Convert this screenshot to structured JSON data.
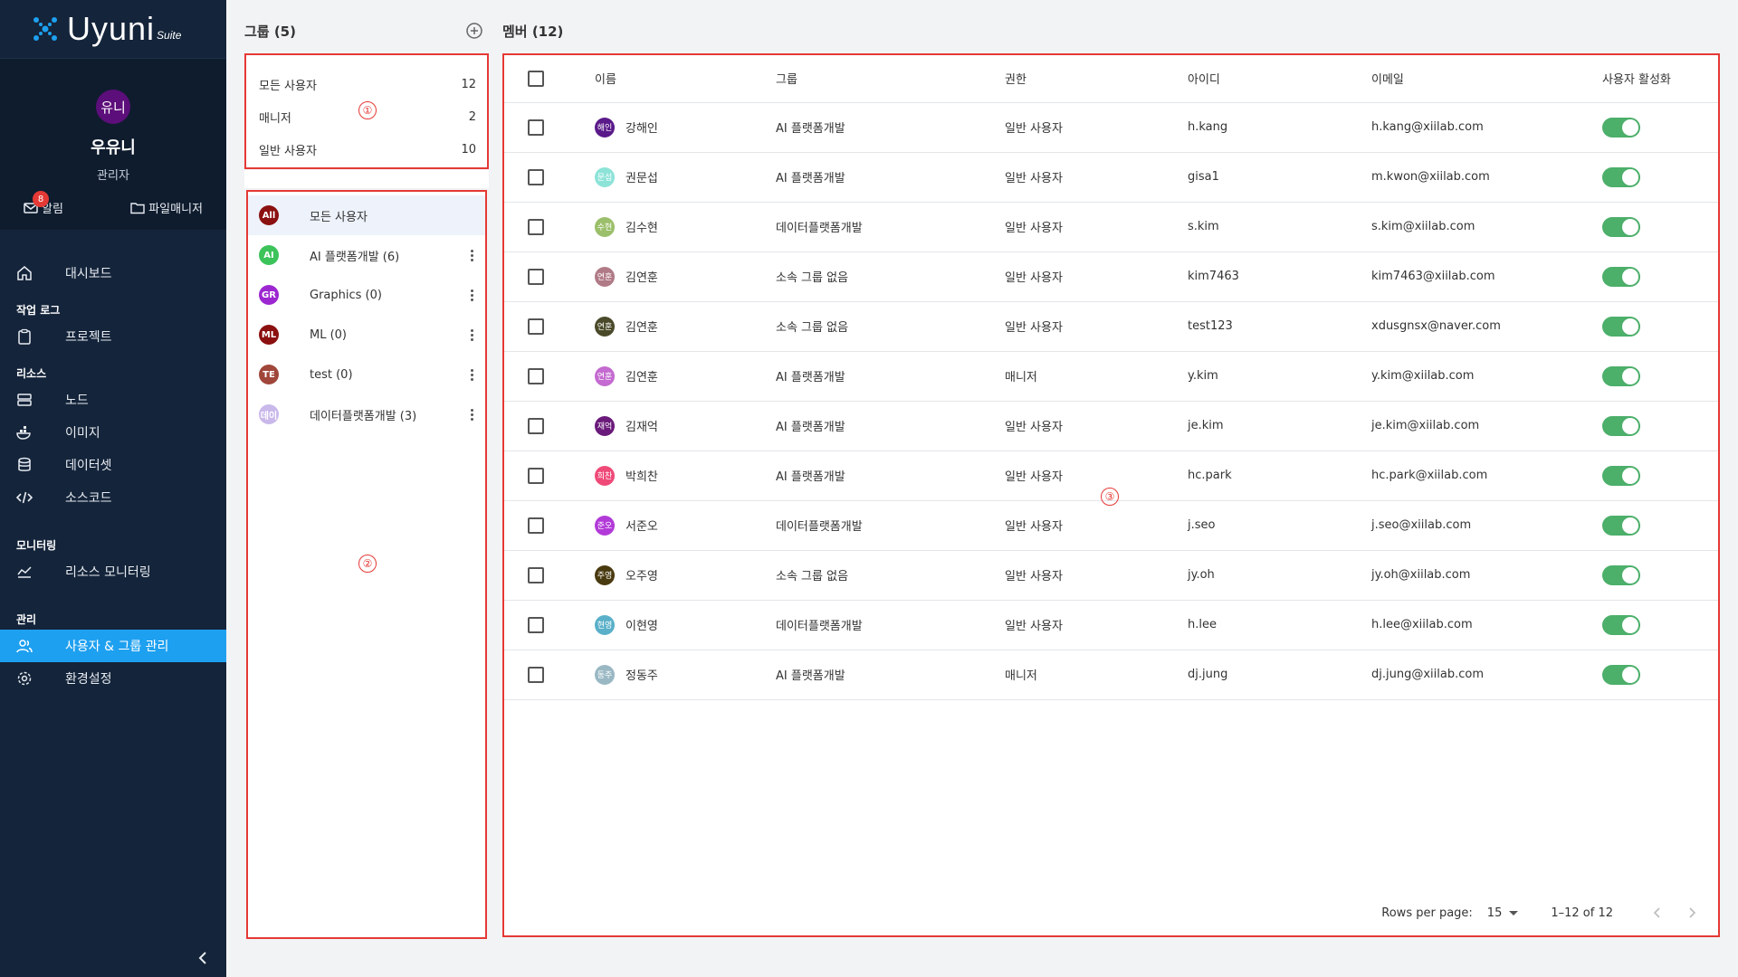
{
  "app": {
    "logo_text": "Uyuni",
    "logo_suite": "Suite"
  },
  "profile": {
    "avatar_text": "유니",
    "name": "우유니",
    "role": "관리자",
    "notifications_label": "알림",
    "notifications_count": "8",
    "file_manager_label": "파일매니저"
  },
  "nav": {
    "dashboard": "대시보드",
    "worklog_section": "작업 로그",
    "project": "프로젝트",
    "resources_section": "리소스",
    "node": "노드",
    "image": "이미지",
    "dataset": "데이터셋",
    "source": "소스코드",
    "monitoring_section": "모니터링",
    "resource_monitoring": "리소스 모니터링",
    "admin_section": "관리",
    "user_group": "사용자 & 그룹 관리",
    "settings": "환경설정"
  },
  "groups": {
    "title": "그룹 (5)",
    "summary": [
      {
        "label": "모든 사용자",
        "count": "12"
      },
      {
        "label": "매니저",
        "count": "2"
      },
      {
        "label": "일반 사용자",
        "count": "10"
      }
    ],
    "list": [
      {
        "badge": "All",
        "label": "모든 사용자",
        "color": "#8b1010"
      },
      {
        "badge": "AI",
        "label": "AI 플랫폼개발 (6)",
        "color": "#3cc35a"
      },
      {
        "badge": "GR",
        "label": "Graphics (0)",
        "color": "#9c27d0"
      },
      {
        "badge": "ML",
        "label": "ML (0)",
        "color": "#8b1010"
      },
      {
        "badge": "TE",
        "label": "test (0)",
        "color": "#a0463a"
      },
      {
        "badge": "데이",
        "label": "데이터플랫폼개발 (3)",
        "color": "#c9b8ea"
      }
    ]
  },
  "members": {
    "title": "멤버 (12)",
    "headers": {
      "name": "이름",
      "group": "그룹",
      "role": "권한",
      "id": "아이디",
      "email": "이메일",
      "active": "사용자 활성화"
    },
    "rows": [
      {
        "avatar": "해인",
        "color": "#5a1a8a",
        "name": "강해인",
        "group": "AI 플랫폼개발",
        "role": "일반 사용자",
        "id": "h.kang",
        "email": "h.kang@xiilab.com"
      },
      {
        "avatar": "문섭",
        "color": "#8de3d8",
        "name": "권문섭",
        "group": "AI 플랫폼개발",
        "role": "일반 사용자",
        "id": "gisa1",
        "email": "m.kwon@xiilab.com"
      },
      {
        "avatar": "수현",
        "color": "#9bbf6a",
        "name": "김수현",
        "group": "데이터플랫폼개발",
        "role": "일반 사용자",
        "id": "s.kim",
        "email": "s.kim@xiilab.com"
      },
      {
        "avatar": "연훈",
        "color": "#b07a86",
        "name": "김연훈",
        "group": "소속 그룹 없음",
        "role": "일반 사용자",
        "id": "kim7463",
        "email": "kim7463@xiilab.com"
      },
      {
        "avatar": "연훈",
        "color": "#4a4a2a",
        "name": "김연훈",
        "group": "소속 그룹 없음",
        "role": "일반 사용자",
        "id": "test123",
        "email": "xdusgnsx@naver.com"
      },
      {
        "avatar": "연훈",
        "color": "#c46ad0",
        "name": "김연훈",
        "group": "AI 플랫폼개발",
        "role": "매니저",
        "id": "y.kim",
        "email": "y.kim@xiilab.com"
      },
      {
        "avatar": "재억",
        "color": "#6a1a7a",
        "name": "김재억",
        "group": "AI 플랫폼개발",
        "role": "일반 사용자",
        "id": "je.kim",
        "email": "je.kim@xiilab.com"
      },
      {
        "avatar": "희찬",
        "color": "#ef4a78",
        "name": "박희찬",
        "group": "AI 플랫폼개발",
        "role": "일반 사용자",
        "id": "hc.park",
        "email": "hc.park@xiilab.com"
      },
      {
        "avatar": "준오",
        "color": "#b23ad8",
        "name": "서준오",
        "group": "데이터플랫폼개발",
        "role": "일반 사용자",
        "id": "j.seo",
        "email": "j.seo@xiilab.com"
      },
      {
        "avatar": "주영",
        "color": "#4a3a10",
        "name": "오주영",
        "group": "소속 그룹 없음",
        "role": "일반 사용자",
        "id": "jy.oh",
        "email": "jy.oh@xiilab.com"
      },
      {
        "avatar": "현영",
        "color": "#5ab0c8",
        "name": "이현영",
        "group": "데이터플랫폼개발",
        "role": "일반 사용자",
        "id": "h.lee",
        "email": "h.lee@xiilab.com"
      },
      {
        "avatar": "동주",
        "color": "#9ab8c4",
        "name": "정동주",
        "group": "AI 플랫폼개발",
        "role": "매니저",
        "id": "dj.jung",
        "email": "dj.jung@xiilab.com"
      }
    ],
    "pagination": {
      "rows_label": "Rows per page:",
      "rows_value": "15",
      "range": "1–12 of 12"
    }
  },
  "markers": {
    "m1": "①",
    "m2": "②",
    "m3": "③"
  },
  "colors": {
    "sidebar": "#14243a",
    "active_nav": "#1ea0f0",
    "toggle_on": "#4caf6a",
    "highlight": "#e53935"
  }
}
